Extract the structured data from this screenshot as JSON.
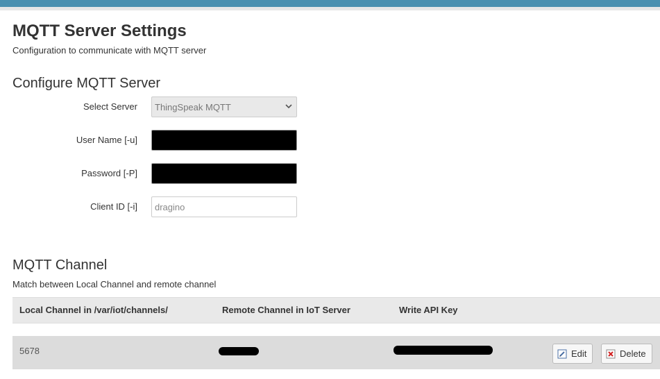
{
  "page": {
    "title": "MQTT Server Settings",
    "description": "Configuration to communicate with MQTT server"
  },
  "server_section": {
    "title": "Configure MQTT Server",
    "fields": {
      "server": {
        "label": "Select Server",
        "value": "ThingSpeak MQTT"
      },
      "username": {
        "label": "User Name [-u]"
      },
      "password": {
        "label": "Password [-P]"
      },
      "client_id": {
        "label": "Client ID [-i]",
        "placeholder": "dragino"
      }
    }
  },
  "channel_section": {
    "title": "MQTT Channel",
    "description": "Match between Local Channel and remote channel",
    "columns": [
      "Local Channel in /var/iot/channels/",
      "Remote Channel in IoT Server",
      "Write API Key"
    ],
    "rows": [
      {
        "local_channel": "5678"
      }
    ],
    "edit_label": "Edit",
    "delete_label": "Delete"
  },
  "colors": {
    "topbar": "#4a90b0",
    "table_header": "#e9e9e9",
    "table_row": "#dcdcdc"
  },
  "icons": {
    "edit": "edit-pencil-icon",
    "delete": "delete-x-icon",
    "select": "chevron-down-icon"
  }
}
